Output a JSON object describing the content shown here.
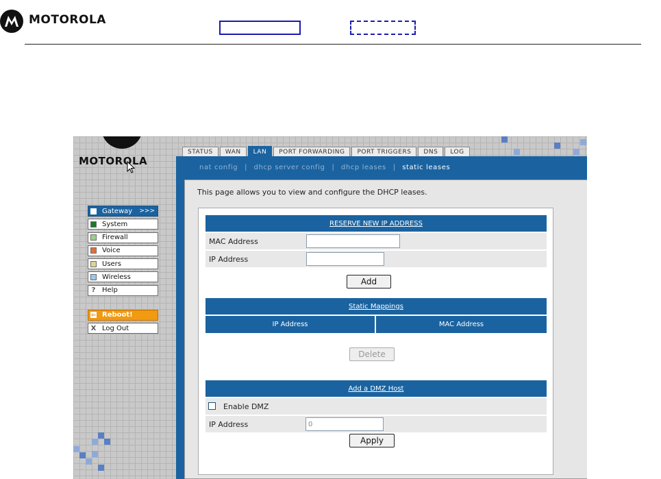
{
  "doc_header": {
    "brand": "MOTOROLA"
  },
  "ui": {
    "brand": "MOTOROLA",
    "menu": [
      {
        "label": "Gateway",
        "color": "#ffffff",
        "arrows": ">>>"
      },
      {
        "label": "System",
        "color": "#1a7a2a"
      },
      {
        "label": "Firewall",
        "color": "#9ccf8a"
      },
      {
        "label": "Voice",
        "color": "#e07040"
      },
      {
        "label": "Users",
        "color": "#d8d890"
      },
      {
        "label": "Wireless",
        "color": "#9cc8ee"
      },
      {
        "label": "Help",
        "icon": "?"
      }
    ],
    "reboot_label": "Reboot!",
    "reboot_icon": "⇦",
    "logout_label": "Log Out",
    "logout_icon": "X",
    "tabs": [
      "STATUS",
      "WAN",
      "LAN",
      "PORT FORWARDING",
      "PORT TRIGGERS",
      "DNS",
      "LOG"
    ],
    "subtabs": [
      "nat config",
      "dhcp server config",
      "dhcp leases",
      "static leases"
    ],
    "intro": "This page allows you to view and configure the DHCP leases.",
    "reserve": {
      "title": "RESERVE NEW IP ADDRESS",
      "mac_label": "MAC Address",
      "ip_label": "IP Address",
      "mac_value": "",
      "ip_value": "",
      "add_label": "Add"
    },
    "static": {
      "title": "Static Mappings",
      "col_ip": "IP Address",
      "col_mac": "MAC Address",
      "delete_label": "Delete"
    },
    "dmz": {
      "title": "Add a DMZ Host",
      "enable_label": "Enable DMZ",
      "ip_label": "IP Address",
      "ip_value": "0",
      "apply_label": "Apply"
    }
  }
}
